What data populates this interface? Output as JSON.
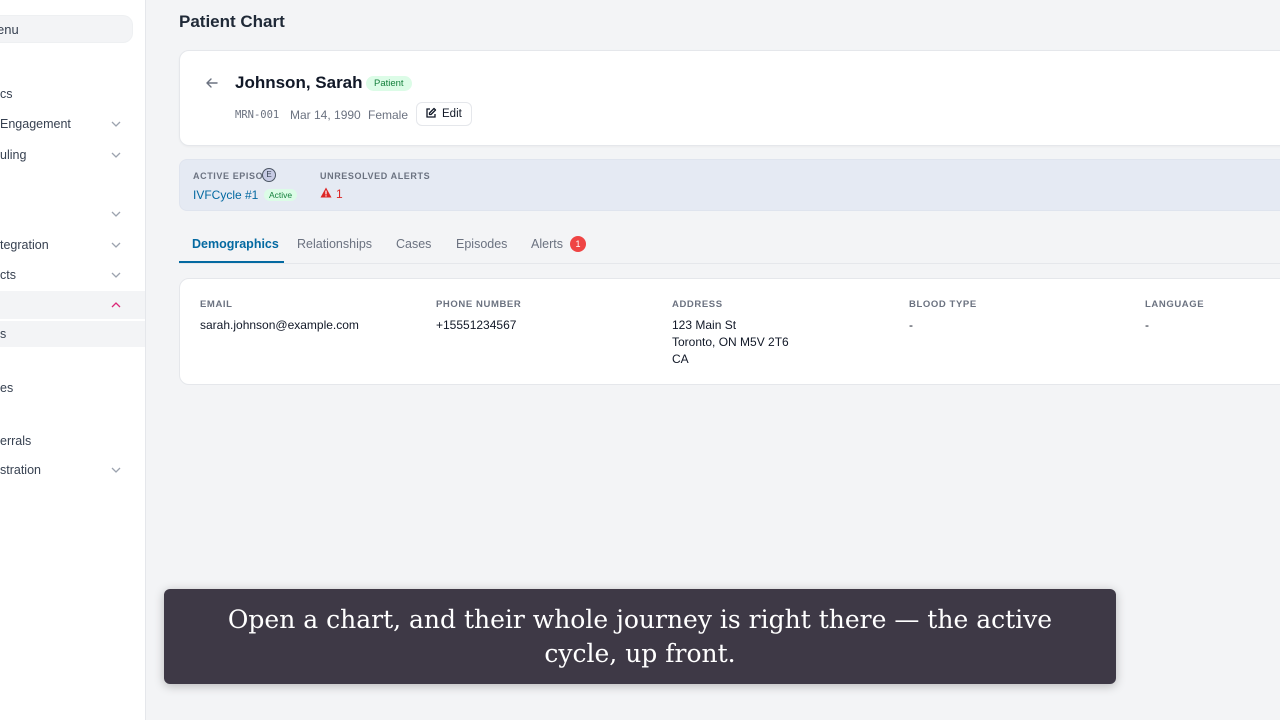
{
  "sidebar": {
    "menu_label": "enu",
    "items": [
      {
        "label": "cs",
        "has_chevron": false
      },
      {
        "label": " Engagement",
        "has_chevron": true
      },
      {
        "label": "uling",
        "has_chevron": true
      },
      {
        "label": "",
        "has_chevron": true
      },
      {
        "label": "tegration",
        "has_chevron": true
      },
      {
        "label": "cts",
        "has_chevron": true
      },
      {
        "label": "",
        "has_chevron": true,
        "expanded": true
      },
      {
        "label": "s",
        "sub": true
      },
      {
        "label": "es",
        "has_chevron": false
      },
      {
        "label": "errals",
        "has_chevron": false
      },
      {
        "label": "stration",
        "has_chevron": true
      }
    ]
  },
  "header": {
    "title": "Patient Chart"
  },
  "patient": {
    "name": "Johnson, Sarah",
    "badge": "Patient",
    "mrn": "MRN-001",
    "dob": "Mar 14, 1990",
    "gender": "Female",
    "edit_label": "Edit"
  },
  "episode_bar": {
    "active_episode_label": "ACTIVE EPISODE",
    "active_episode_visible": "ACTIVE EPISO",
    "episode_link": "IVFCycle #1",
    "episode_status": "Active",
    "info_glyph": "E",
    "alerts_label": "UNRESOLVED ALERTS",
    "alerts_count": "1"
  },
  "tabs": [
    {
      "label": "Demographics",
      "active": true
    },
    {
      "label": "Relationships"
    },
    {
      "label": "Cases"
    },
    {
      "label": "Episodes"
    },
    {
      "label": "Alerts",
      "badge": "1"
    }
  ],
  "demographics": {
    "email": {
      "label": "EMAIL",
      "value": "sarah.johnson@example.com"
    },
    "phone": {
      "label": "PHONE NUMBER",
      "value": "+15551234567"
    },
    "address": {
      "label": "ADDRESS",
      "value": "123 Main St\nToronto, ON M5V 2T6\nCA"
    },
    "blood_type": {
      "label": "BLOOD TYPE",
      "value": "-"
    },
    "language": {
      "label": "LANGUAGE",
      "value": "-"
    }
  },
  "caption": {
    "text": "Open a chart, and their whole journey is right there — the active cycle, up front."
  },
  "colors": {
    "accent": "#0369a1",
    "success_bg": "#dcfce7",
    "success_text": "#15803d",
    "alert": "#dc2626",
    "episode_bar_bg": "#e5eaf3"
  },
  "icons": {
    "back": "arrow-left-icon",
    "edit": "pencil-square-icon",
    "alert": "warning-triangle-icon",
    "chevron": "chevron-down-icon"
  }
}
